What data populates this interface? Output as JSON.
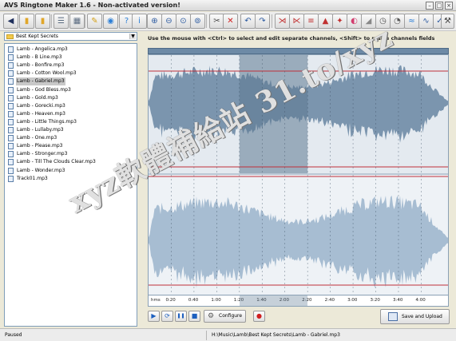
{
  "window": {
    "title": "AVS Ringtone Maker 1.6 - Non-activated version!",
    "controls": [
      {
        "name": "minimize",
        "glyph": "–"
      },
      {
        "name": "maximize",
        "glyph": "□"
      },
      {
        "name": "close",
        "glyph": "×"
      }
    ]
  },
  "toolbar": {
    "buttons": [
      {
        "name": "back-icon",
        "glyph": "◀",
        "color": "#1f2f5c"
      },
      {
        "name": "open-file-icon",
        "glyph": "▮",
        "color": "#e0a62a"
      },
      {
        "name": "open-folder-icon",
        "glyph": "▮",
        "color": "#e0a62a"
      },
      {
        "name": "list-view-icon",
        "glyph": "☰",
        "color": "#5a6b80"
      },
      {
        "name": "details-view-icon",
        "glyph": "▦",
        "color": "#5a6b80"
      },
      {
        "name": "edit-tag-icon",
        "glyph": "✎",
        "color": "#d4a017"
      },
      {
        "name": "web-icon",
        "glyph": "◉",
        "color": "#2c7fd6"
      },
      {
        "name": "help-icon",
        "glyph": "?",
        "color": "#2c7fd6"
      },
      {
        "name": "info-icon",
        "glyph": "i",
        "color": "#2c7fd6"
      },
      {
        "name": "zoom-in-icon",
        "glyph": "⊕",
        "color": "#2c5aa0"
      },
      {
        "name": "zoom-out-icon",
        "glyph": "⊖",
        "color": "#2c5aa0"
      },
      {
        "name": "zoom-selection-icon",
        "glyph": "⊙",
        "color": "#2c5aa0"
      },
      {
        "name": "zoom-all-icon",
        "glyph": "⊚",
        "color": "#2c5aa0"
      },
      {
        "name": "cut-icon",
        "glyph": "✂",
        "color": "#444"
      },
      {
        "name": "delete-icon",
        "glyph": "✕",
        "color": "#d02020"
      },
      {
        "name": "undo-icon",
        "glyph": "↶",
        "color": "#2c5aa0"
      },
      {
        "name": "redo-icon",
        "glyph": "↷",
        "color": "#2c5aa0"
      },
      {
        "name": "fade-out-icon",
        "glyph": "⋊",
        "color": "#c03030"
      },
      {
        "name": "fade-in-icon",
        "glyph": "⋉",
        "color": "#c03030"
      },
      {
        "name": "normalize-icon",
        "glyph": "≡",
        "color": "#c03030"
      },
      {
        "name": "amplify-icon",
        "glyph": "▲",
        "color": "#c03030"
      },
      {
        "name": "effect-icon",
        "glyph": "✦",
        "color": "#c03030"
      },
      {
        "name": "reverse-icon",
        "glyph": "◐",
        "color": "#d23c6e"
      },
      {
        "name": "silence-icon",
        "glyph": "◢",
        "color": "#888"
      },
      {
        "name": "tempo-icon",
        "glyph": "◷",
        "color": "#555"
      },
      {
        "name": "pitch-icon",
        "glyph": "◔",
        "color": "#555"
      },
      {
        "name": "echo-icon",
        "glyph": "≈",
        "color": "#2c7fd6"
      },
      {
        "name": "eq-icon",
        "glyph": "∿",
        "color": "#2c5aa0"
      },
      {
        "name": "noise-icon",
        "glyph": "✓",
        "color": "#2c5aa0"
      },
      {
        "name": "settings-icon",
        "glyph": "⚒",
        "color": "#444"
      }
    ]
  },
  "browser": {
    "folder": "Best Kept Secrets",
    "files": [
      "Lamb - Angelica.mp3",
      "Lamb - B Line.mp3",
      "Lamb - Bonfire.mp3",
      "Lamb - Cotton Wool.mp3",
      "Lamb - Gabriel.mp3",
      "Lamb - God Bless.mp3",
      "Lamb - Gold.mp3",
      "Lamb - Gorecki.mp3",
      "Lamb - Heaven.mp3",
      "Lamb - Little Things.mp3",
      "Lamb - Lullaby.mp3",
      "Lamb - One.mp3",
      "Lamb - Please.mp3",
      "Lamb - Stronger.mp3",
      "Lamb - Till The Clouds Clear.mp3",
      "Lamb - Wonder.mp3",
      "Track01.mp3"
    ],
    "selected": 4
  },
  "editor": {
    "hint": "Use the mouse with <Ctrl> to select and edit separate channels, <Shift> to resize channels fields",
    "unit_label": "hms",
    "time_ticks": [
      "0:20",
      "0:40",
      "1:00",
      "1:20",
      "1:40",
      "2:00",
      "2:20",
      "2:40",
      "3:00",
      "3:20",
      "3:40",
      "4:00"
    ],
    "selection_seconds": [
      80,
      140
    ],
    "total_seconds": 265,
    "colors": {
      "upper_wave": "#7b95ae",
      "lower_wave": "#a7bdd2",
      "selection": "#5c7892",
      "marker": "#c0303a"
    }
  },
  "transport": {
    "buttons": [
      {
        "name": "play-icon",
        "glyph": "▶"
      },
      {
        "name": "loop-icon",
        "glyph": "⟳"
      },
      {
        "name": "pause-icon",
        "glyph": "❚❚"
      },
      {
        "name": "stop-icon",
        "glyph": "■"
      }
    ],
    "configure_label": "Configure",
    "record_glyph": "●",
    "save_label": "Save and Upload"
  },
  "status": {
    "state": "Paused",
    "path": "H:\\Music\\Lamb\\Best Kept Secrets\\Lamb - Gabriel.mp3"
  },
  "overlay": {
    "watermark": "xyz軟體補給站 31.to/xyz"
  }
}
